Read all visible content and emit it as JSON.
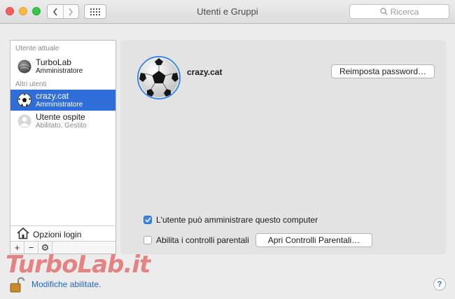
{
  "window": {
    "title": "Utenti e Gruppi",
    "search_placeholder": "Ricerca"
  },
  "sidebar": {
    "current_section_label": "Utente attuale",
    "current_user": {
      "name": "TurboLab",
      "role": "Amministratore"
    },
    "others_section_label": "Altri utenti",
    "other_users": [
      {
        "name": "crazy.cat",
        "role": "Amministratore",
        "selected": true
      },
      {
        "name": "Utente ospite",
        "role": "Abilitato, Gestito",
        "selected": false
      }
    ],
    "login_options_label": "Opzioni login",
    "bottom_buttons": [
      "+",
      "−",
      "⚙"
    ]
  },
  "panel": {
    "username": "crazy.cat",
    "reset_password_label": "Reimposta password…",
    "admin_checkbox": {
      "label": "L'utente può amministrare questo computer",
      "checked": true
    },
    "parental_checkbox": {
      "label": "Abilita i controlli parentali",
      "checked": false
    },
    "open_parental_label": "Apri Controlli Parentali…"
  },
  "footer": {
    "status_text": "Modifiche abilitate.",
    "help_label": "?"
  },
  "watermark": {
    "text": "TurboLab.it"
  },
  "colors": {
    "selection": "#2f6ed9",
    "accent": "#3a86e8",
    "link": "#2466c9"
  }
}
